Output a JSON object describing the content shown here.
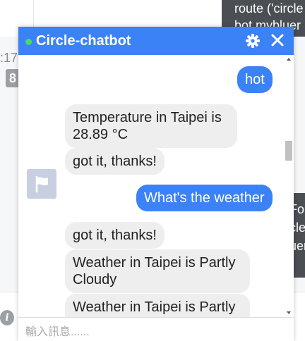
{
  "background": {
    "timestamp_fragment": ":17",
    "badge_fragment": "8",
    "dark_top_text": "route ('circle\nbot.mybluer",
    "dark_mid_text": "Fo\ncle\nuer",
    "info_icon": "info-icon"
  },
  "chat": {
    "title": "Circle-chatbot",
    "status": "online",
    "icons": {
      "settings": "gear-icon",
      "close": "close-icon",
      "avatar": "flag-icon"
    },
    "messages": [
      {
        "from": "user",
        "text": "hot"
      },
      {
        "from": "bot",
        "text": "Temperature in Taipei is 28.89 °C"
      },
      {
        "from": "bot",
        "text": "got it, thanks!"
      },
      {
        "from": "user",
        "text": "What's the weather"
      },
      {
        "from": "bot",
        "text": "got it, thanks!"
      },
      {
        "from": "bot",
        "text": "Weather in Taipei is Partly Cloudy"
      },
      {
        "from": "bot",
        "text": "Weather in Taipei is Partly Cloudy"
      }
    ],
    "input_placeholder": "輸入訊息......"
  },
  "colors": {
    "accent": "#3b82f6",
    "bot_bubble": "#eeeeef",
    "online": "#4cd964"
  }
}
